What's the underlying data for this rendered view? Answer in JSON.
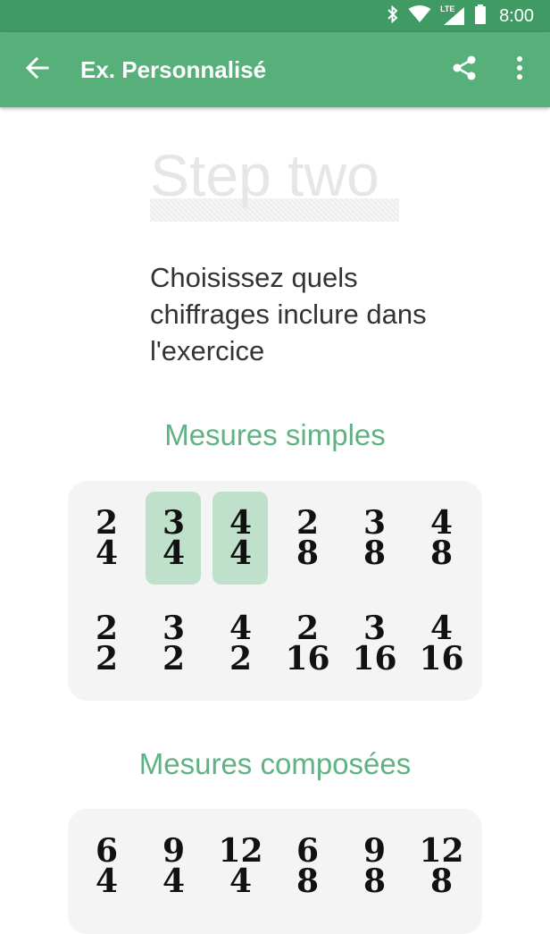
{
  "status_bar": {
    "network_label": "LTE",
    "time": "8:00"
  },
  "app_bar": {
    "title": "Ex. Personnalisé"
  },
  "content": {
    "step_title": "Step two",
    "instructions": "Choisissez quels chiffrages inclure dans l'exercice"
  },
  "simple": {
    "title": "Mesures simples",
    "items": [
      {
        "num": "2",
        "den": "4",
        "selected": false
      },
      {
        "num": "3",
        "den": "4",
        "selected": true
      },
      {
        "num": "4",
        "den": "4",
        "selected": true
      },
      {
        "num": "2",
        "den": "8",
        "selected": false
      },
      {
        "num": "3",
        "den": "8",
        "selected": false
      },
      {
        "num": "4",
        "den": "8",
        "selected": false
      },
      {
        "num": "2",
        "den": "2",
        "selected": false
      },
      {
        "num": "3",
        "den": "2",
        "selected": false
      },
      {
        "num": "4",
        "den": "2",
        "selected": false
      },
      {
        "num": "2",
        "den": "16",
        "selected": false
      },
      {
        "num": "3",
        "den": "16",
        "selected": false
      },
      {
        "num": "4",
        "den": "16",
        "selected": false
      }
    ]
  },
  "compound": {
    "title": "Mesures composées",
    "items": [
      {
        "num": "6",
        "den": "4",
        "selected": false
      },
      {
        "num": "9",
        "den": "4",
        "selected": false
      },
      {
        "num": "12",
        "den": "4",
        "selected": false
      },
      {
        "num": "6",
        "den": "8",
        "selected": false
      },
      {
        "num": "9",
        "den": "8",
        "selected": false
      },
      {
        "num": "12",
        "den": "8",
        "selected": false
      }
    ]
  },
  "colors": {
    "app_bar": "#57b07a",
    "status_bar": "#3f9a63",
    "accent_text": "#5fb382",
    "selected_bg": "#bfe0cb"
  },
  "icons": [
    "bluetooth-icon",
    "wifi-icon",
    "signal-icon",
    "battery-icon",
    "back-arrow-icon",
    "share-icon",
    "more-vert-icon"
  ]
}
